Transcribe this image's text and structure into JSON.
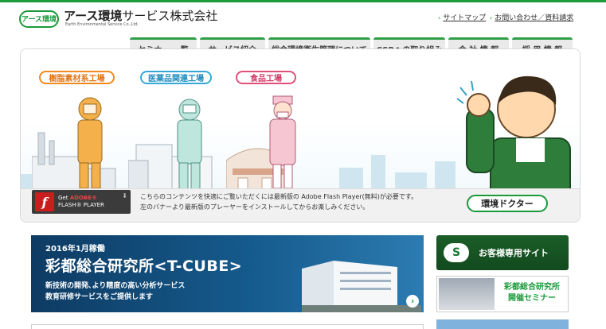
{
  "header": {
    "logo_mark": "アース環境",
    "company_bold": "アース環境",
    "company_rest": "サービス株式会社",
    "company_en": "Earth Environmental Service Co.,Ltd.",
    "links": [
      "サイトマップ",
      "お問い合わせ／資料請求"
    ]
  },
  "nav": {
    "items": [
      "セミナー 一覧",
      "サービス紹介",
      "総合環境衛生管理について",
      "CSRへの取り組み",
      "会 社 情 報",
      "採 用 情 報"
    ]
  },
  "flash": {
    "labels": [
      "樹脂素材系工場",
      "医薬品関連工場",
      "食品工場"
    ],
    "label_colors": [
      "#f08a1c",
      "#35a8d8",
      "#e2507a"
    ],
    "badge_line1_pre": "Get ",
    "badge_line1_brand": "ADOBE®",
    "badge_line2": "FLASH® PLAYER",
    "notice_lines": [
      "こちらのコンテンツを快適にご覧いただくには最新版の Adobe Flash Player(無料)が必要です。",
      "左のバナーより最新版のプレーヤーをインストールしてからお楽しみください。"
    ],
    "doctor_label": "環境ドクター"
  },
  "banners": {
    "tcube": {
      "date": "2016年1月稼働",
      "title": "彩都総合研究所<T-CUBE>",
      "desc_lines": [
        "新技術の開発､より精度の高い分析サービス",
        "教育研修サービスをご提供します"
      ]
    },
    "customer": {
      "label": "お客様専用サイト"
    },
    "seminar": {
      "lines": [
        "彩都総合研究所",
        "開催セミナー"
      ]
    }
  },
  "colors": {
    "brand_green": "#1a9a3a",
    "banner_blue": "#155a8c"
  }
}
